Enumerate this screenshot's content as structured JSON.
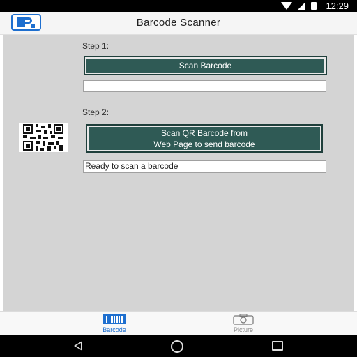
{
  "status_bar": {
    "time": "12:29"
  },
  "app_bar": {
    "title": "Barcode Scanner"
  },
  "step1": {
    "label": "Step 1:",
    "button_label": "Scan Barcode",
    "result_value": ""
  },
  "step2": {
    "label": "Step 2:",
    "button_line1": "Scan QR Barcode from",
    "button_line2": "Web Page to send barcode",
    "status_value": "Ready to scan a barcode"
  },
  "bottom_nav": {
    "tabs": [
      {
        "label": "Barcode",
        "icon": "barcode-icon",
        "selected": true
      },
      {
        "label": "Picture",
        "icon": "camera-icon",
        "selected": false
      }
    ]
  },
  "colors": {
    "accent": "#1e6fcf",
    "button_bg": "#2f5a55",
    "content_bg": "#d4d4d4"
  }
}
